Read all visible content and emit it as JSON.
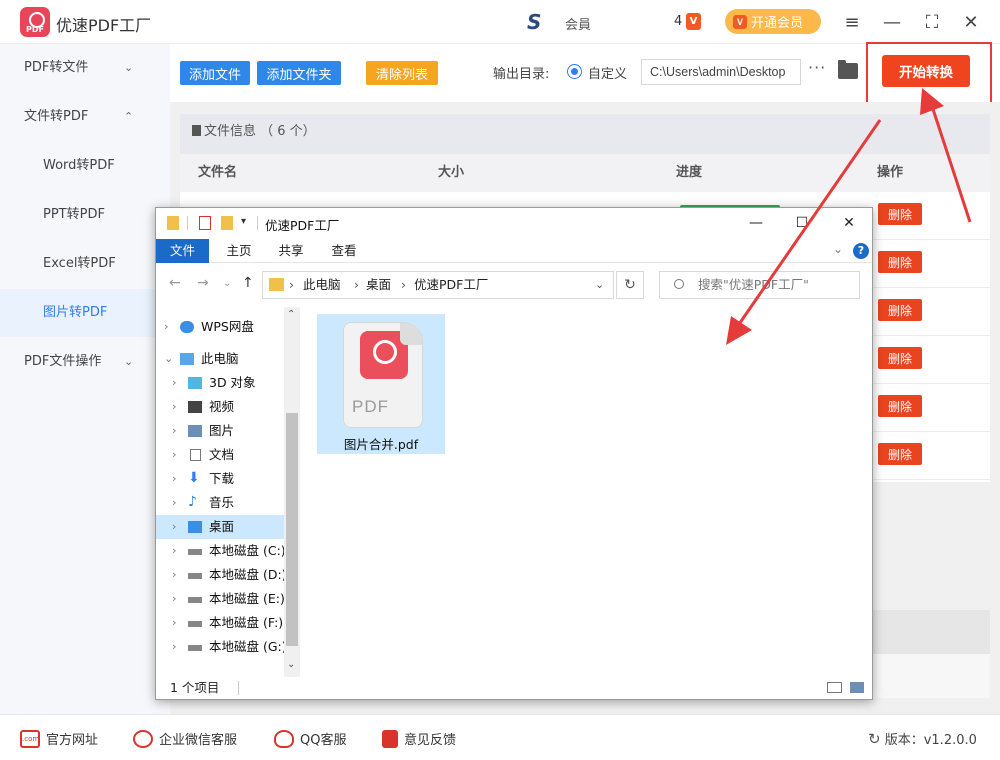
{
  "app": {
    "title": "优速PDF工厂",
    "user_name": "会員",
    "vip_count": "4",
    "vip_badge": "V",
    "vip_button": "开通会员"
  },
  "sidebar": {
    "items": [
      {
        "label": "PDF转文件",
        "chevron": "⌄"
      },
      {
        "label": "文件转PDF",
        "chevron": "⌃"
      },
      {
        "label": "Word转PDF"
      },
      {
        "label": "PPT转PDF"
      },
      {
        "label": "Excel转PDF"
      },
      {
        "label": "图片转PDF"
      },
      {
        "label": "PDF文件操作",
        "chevron": "⌄"
      }
    ]
  },
  "toolbar": {
    "add_file": "添加文件",
    "add_folder": "添加文件夹",
    "clear_list": "清除列表",
    "output_label": "输出目录:",
    "radio_label": "自定义",
    "output_path": "C:\\Users\\admin\\Desktop",
    "more": "···",
    "start": "开始转换"
  },
  "table": {
    "info": "文件信息 （ 6 个）",
    "headers": [
      "文件名",
      "大小",
      "进度",
      "操作"
    ],
    "delete_label": "删除"
  },
  "footer": {
    "site": "官方网址",
    "wechat": "企业微信客服",
    "qq": "QQ客服",
    "feedback": "意见反馈",
    "version": "版本：v1.2.0.0"
  },
  "explorer": {
    "title": "优速PDF工厂",
    "tabs": [
      "文件",
      "主页",
      "共享",
      "查看"
    ],
    "breadcrumb": [
      "此电脑",
      "桌面",
      "优速PDF工厂"
    ],
    "search_placeholder": "搜索\"优速PDF工厂\"",
    "tree": [
      {
        "label": "WPS网盘",
        "indent": 0
      },
      {
        "label": "此电脑",
        "indent": 0
      },
      {
        "label": "3D 对象",
        "indent": 1
      },
      {
        "label": "视频",
        "indent": 1
      },
      {
        "label": "图片",
        "indent": 1
      },
      {
        "label": "文档",
        "indent": 1
      },
      {
        "label": "下载",
        "indent": 1
      },
      {
        "label": "音乐",
        "indent": 1
      },
      {
        "label": "桌面",
        "indent": 1
      },
      {
        "label": "本地磁盘 (C:)",
        "indent": 1
      },
      {
        "label": "本地磁盘 (D:)",
        "indent": 1
      },
      {
        "label": "本地磁盘 (E:)",
        "indent": 1
      },
      {
        "label": "本地磁盘 (F:)",
        "indent": 1
      },
      {
        "label": "本地磁盘 (G:)",
        "indent": 1
      }
    ],
    "file": {
      "name": "图片合并.pdf",
      "icon_text": "PDF"
    },
    "status": "1 个项目"
  },
  "colors": {
    "accent": "#2f7df0",
    "start": "#f0441f",
    "delete": "#e84420",
    "arrow": "#e53b3b"
  }
}
